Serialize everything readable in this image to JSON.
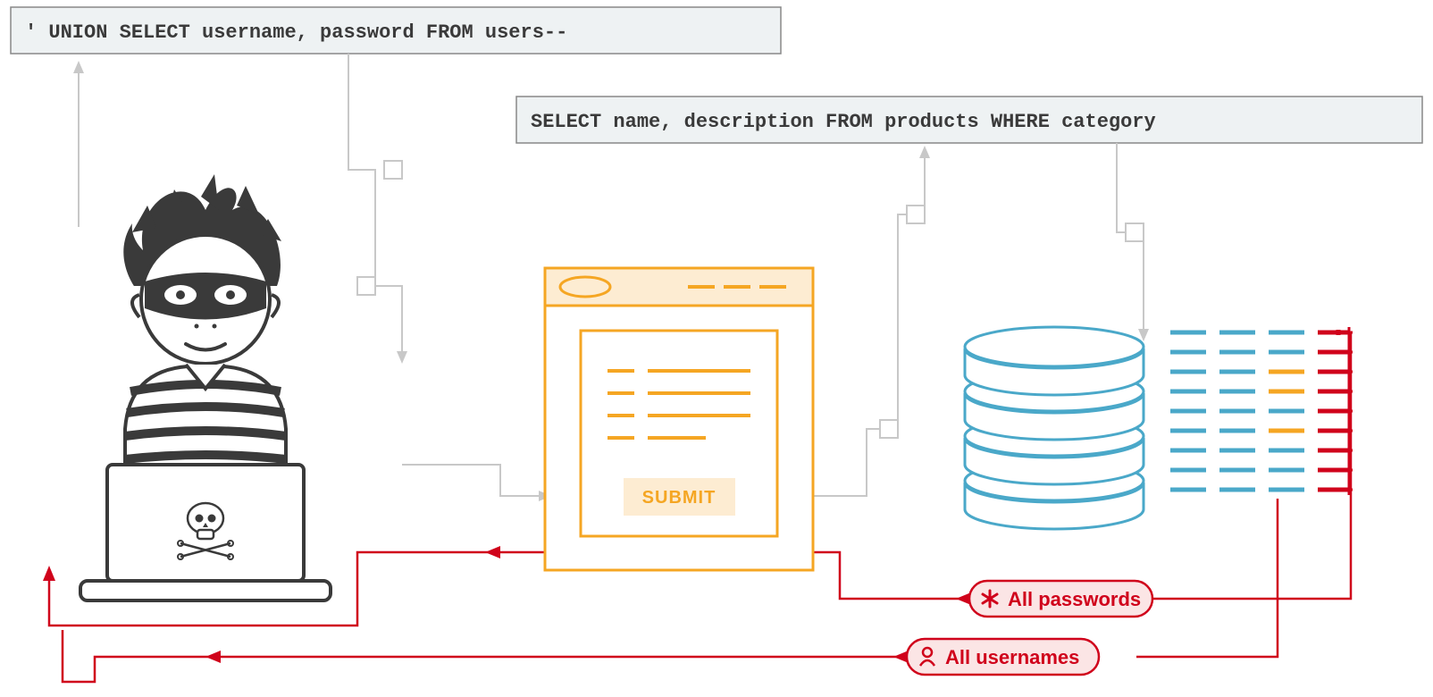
{
  "query1": "' UNION SELECT username, password FROM users--",
  "query2": "SELECT name, description FROM products WHERE category",
  "form": {
    "submit_label": "SUBMIT"
  },
  "pills": {
    "passwords": "All passwords",
    "usernames": "All usernames"
  },
  "colors": {
    "orange": "#f5a623",
    "red": "#d0021b",
    "blue": "#4aa8c9",
    "grey": "#c8c8c8",
    "boxfill": "#eef2f3",
    "boxstroke": "#888888",
    "dark": "#3a3a3a",
    "cream": "#fdecd2",
    "pillfill": "#fbe5e5"
  }
}
